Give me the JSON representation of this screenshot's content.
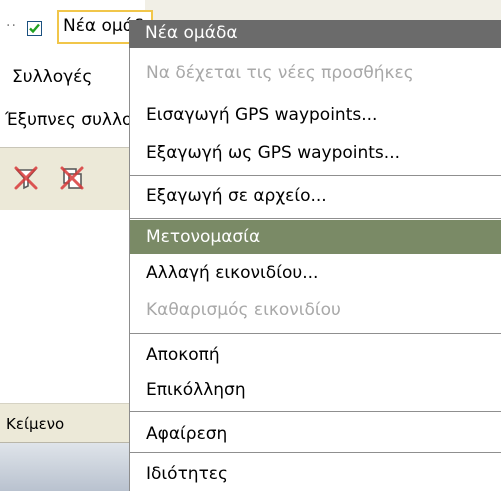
{
  "tree": {
    "dots": "··",
    "checked": true,
    "node_label": "Νέα ομάδα"
  },
  "sidebar": {
    "items": [
      {
        "label": "Συλλογές"
      },
      {
        "label": "Έξυπνες συλλογές"
      }
    ],
    "column_header": "Κείμενο"
  },
  "toolbar": {
    "icons": [
      "filter-remove-icon",
      "copy-remove-icon"
    ]
  },
  "menu": {
    "title": "Νέα ομάδα",
    "items": [
      {
        "label": "Να δέχεται τις νέες προσθήκες",
        "enabled": false
      },
      {
        "label": "Εισαγωγή GPS waypoints...",
        "enabled": true
      },
      {
        "label": "Εξαγωγή ως GPS waypoints...",
        "enabled": true
      },
      {
        "label": "Εξαγωγή σε αρχείο...",
        "enabled": true
      },
      {
        "label": "Μετονομασία",
        "enabled": true,
        "highlighted": true
      },
      {
        "label": "Αλλαγή εικονιδίου...",
        "enabled": true
      },
      {
        "label": "Καθαρισμός εικονιδίου",
        "enabled": false
      },
      {
        "label": "Αποκοπή",
        "enabled": true
      },
      {
        "label": "Επικόλληση",
        "enabled": true
      },
      {
        "label": "Αφαίρεση",
        "enabled": true
      },
      {
        "label": "Ιδιότητες",
        "enabled": true
      }
    ]
  },
  "colors": {
    "menu_title_bg": "#6b6b6b",
    "highlight_bg": "#7a8a66",
    "disabled_text": "#a8a8a8",
    "selection_border": "#f1c64a",
    "icon_red": "#d93a3a"
  }
}
